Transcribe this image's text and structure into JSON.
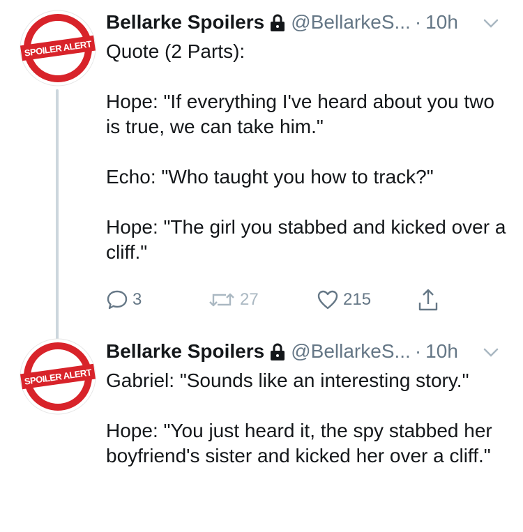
{
  "tweets": [
    {
      "name": "Bellarke Spoilers",
      "handle": "@BellarkeS...",
      "separator": "·",
      "time": "10h",
      "avatar_text": "SPOILER ALERT",
      "icon_lock": "lock-icon",
      "icon_menu": "chevron-down-icon",
      "lines": [
        "Quote (2 Parts):",
        "Hope: \"If everything I've heard about you two is true, we can take him.\"",
        "Echo: \"Who taught you how to track?\"",
        "Hope: \"The girl you stabbed and kicked over a cliff.\""
      ],
      "actions": {
        "reply_count": "3",
        "retweet_count": "27",
        "like_count": "215"
      }
    },
    {
      "name": "Bellarke Spoilers",
      "handle": "@BellarkeS...",
      "separator": "·",
      "time": "10h",
      "avatar_text": "SPOILER ALERT",
      "icon_lock": "lock-icon",
      "icon_menu": "chevron-down-icon",
      "lines": [
        "Gabriel: \"Sounds like an interesting story.\"",
        "Hope: \"You just heard it, the spy stabbed her boyfriend's sister and kicked her over a cliff.\""
      ]
    }
  ],
  "colors": {
    "text": "#14171a",
    "secondary": "#657786",
    "thread_line": "#ccd6dd",
    "avatar_red": "#d8232a"
  }
}
